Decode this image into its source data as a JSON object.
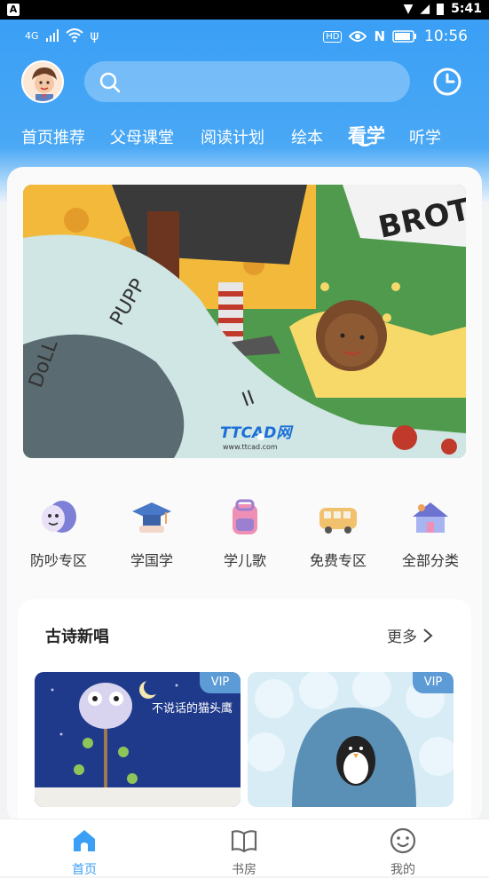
{
  "system_bar": {
    "time": "5:41"
  },
  "status_bar": {
    "network": "4G",
    "time": "10:56"
  },
  "search": {
    "placeholder": ""
  },
  "tabs": [
    {
      "label": "首页推荐"
    },
    {
      "label": "父母课堂"
    },
    {
      "label": "阅读计划"
    },
    {
      "label": "绘本"
    },
    {
      "label": "看学",
      "active": true
    },
    {
      "label": "听学"
    }
  ],
  "banner": {
    "text": "BROT",
    "watermark": "TTCAD网",
    "watermark_url": "www.ttcad.com"
  },
  "categories": [
    {
      "label": "防吵专区",
      "icon": "theater-mask-icon"
    },
    {
      "label": "学国学",
      "icon": "graduation-cap-icon"
    },
    {
      "label": "学儿歌",
      "icon": "backpack-icon"
    },
    {
      "label": "免费专区",
      "icon": "school-bus-icon"
    },
    {
      "label": "全部分类",
      "icon": "house-icon"
    }
  ],
  "section": {
    "title": "古诗新唱",
    "more": "更多",
    "books": [
      {
        "badge": "VIP",
        "cover_text": "不说话的猫头鹰"
      },
      {
        "badge": "VIP",
        "cover_text": ""
      }
    ]
  },
  "bottom_nav": [
    {
      "label": "首页",
      "icon": "home-icon",
      "active": true
    },
    {
      "label": "书房",
      "icon": "book-icon"
    },
    {
      "label": "我的",
      "icon": "smiley-icon"
    }
  ],
  "colors": {
    "primary": "#3a9ff5",
    "vip": "#5d9bd6"
  }
}
